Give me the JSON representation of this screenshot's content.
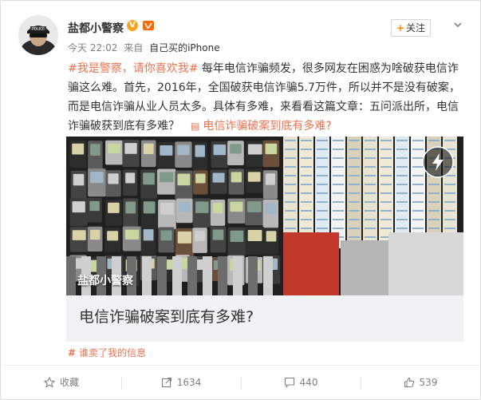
{
  "post": {
    "author": "盐都小警察",
    "verified_badge": "V",
    "meta": {
      "time": "今天 22:02",
      "from": "来自",
      "source": "自己买的iPhone"
    },
    "follow_label": "关注",
    "text": {
      "topic": "#我是警察，请你喜欢我#",
      "body": " 每年电信诈骗频发，很多网友在困惑为啥破获电信诈骗这么难。首先，2016年，全国破获电信诈骗5.7万件，所以并不是没有破案，而是电信诈骗从业人员太多。具体有多难，来看看这篇文章：五问派出所，电信诈骗破获到底有多难？",
      "link_text": "电信诈骗破案到底有多难?"
    },
    "article": {
      "image_label": "盐都小警察",
      "title": "电信诈骗破案到底有多难?"
    },
    "tagline": "谁卖了我的信息",
    "tagline_icon": "hash-icon"
  },
  "footer": {
    "favorite_label": "收藏",
    "repost_count": "1634",
    "comment_count": "440",
    "like_count": "539"
  },
  "colors": {
    "accent": "#eb7350",
    "follow_plus": "#ff8200",
    "badge": "#f6a623"
  }
}
